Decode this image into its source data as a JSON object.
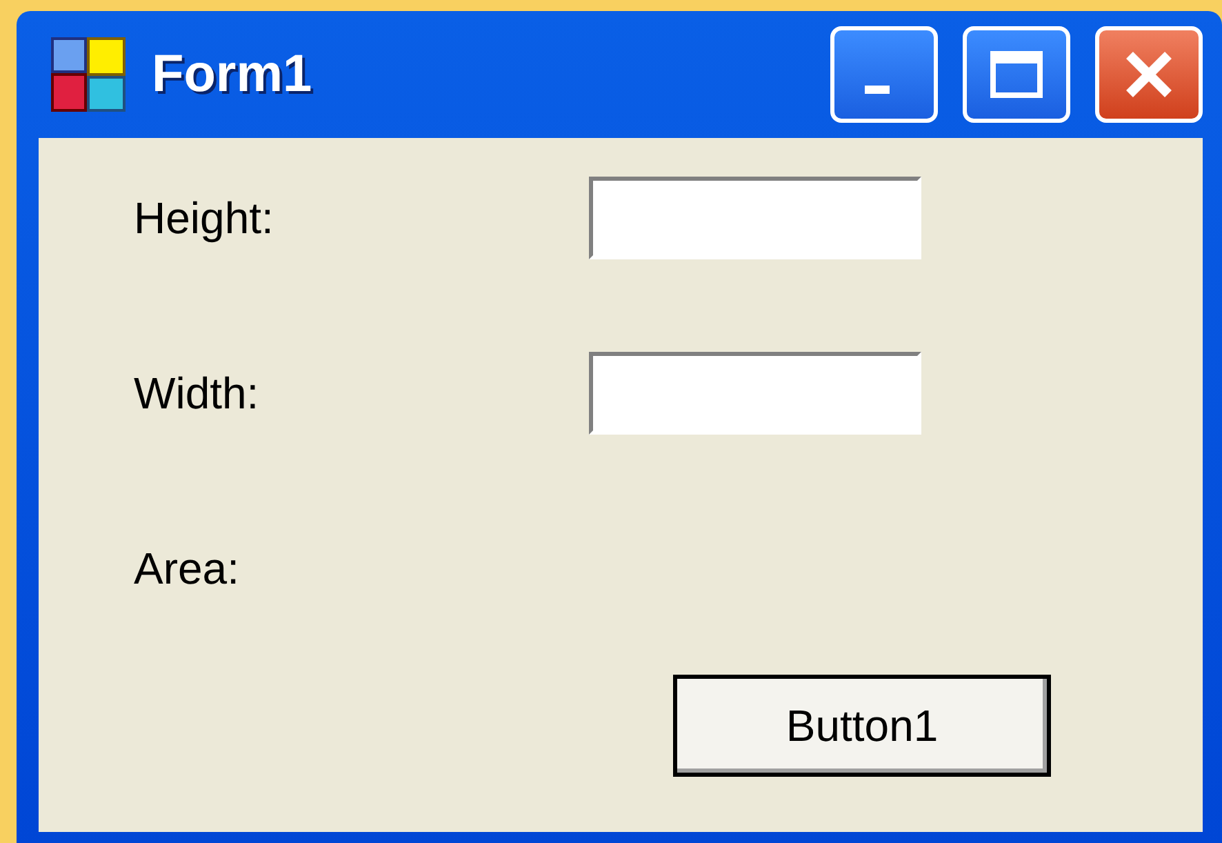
{
  "window": {
    "title": "Form1"
  },
  "fields": [
    {
      "label": "Height:"
    },
    {
      "label": "Width:"
    }
  ],
  "result": {
    "label": "Area:"
  },
  "button": "Button1"
}
